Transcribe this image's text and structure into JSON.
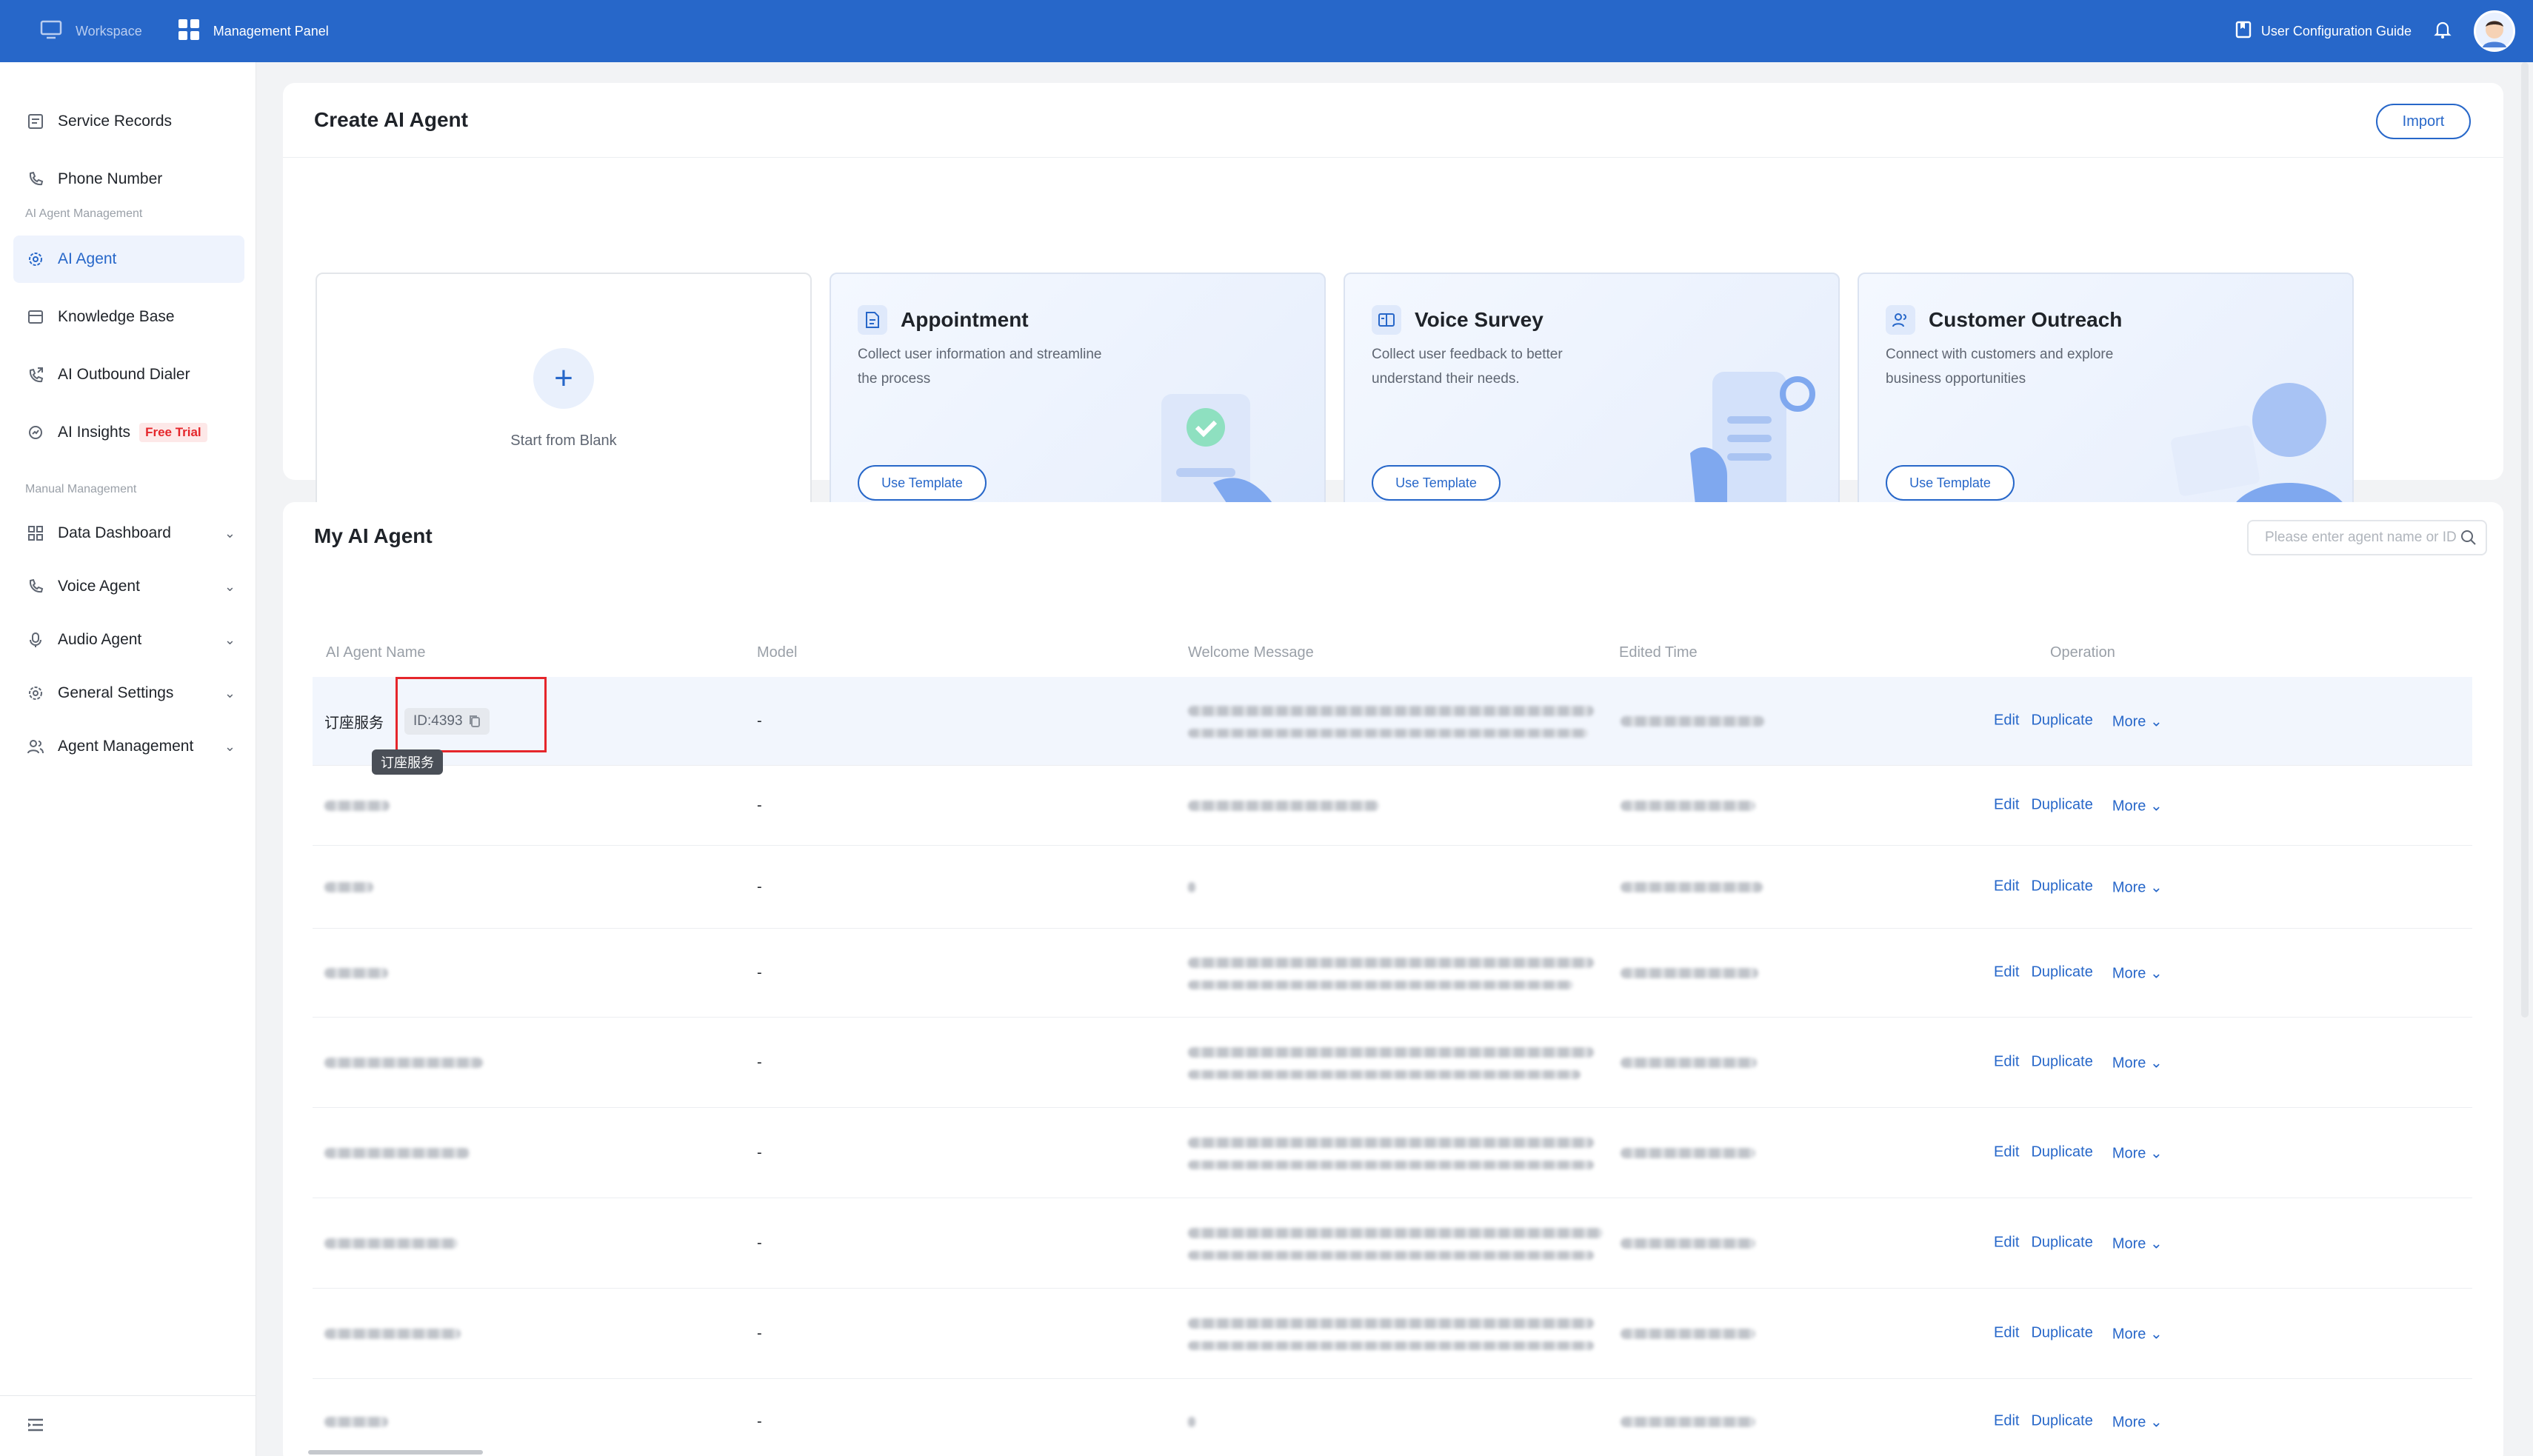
{
  "topbar": {
    "workspace": "Workspace",
    "management_panel": "Management Panel",
    "guide": "User Configuration Guide"
  },
  "sidebar": {
    "items": [
      {
        "label": "Service Records",
        "icon": "document-icon"
      },
      {
        "label": "Phone Number",
        "icon": "phone-icon"
      }
    ],
    "group_ai": "AI Agent Management",
    "ai_items": [
      {
        "label": "AI Agent",
        "icon": "gear-icon",
        "active": true
      },
      {
        "label": "Knowledge Base",
        "icon": "book-icon"
      },
      {
        "label": "AI Outbound Dialer",
        "icon": "phone-outbound-icon"
      },
      {
        "label": "AI Insights",
        "icon": "insights-icon",
        "badge": "Free Trial"
      }
    ],
    "group_manual": "Manual Management",
    "manual_items": [
      {
        "label": "Data Dashboard",
        "icon": "grid-icon"
      },
      {
        "label": "Voice Agent",
        "icon": "phone-icon"
      },
      {
        "label": "Audio Agent",
        "icon": "mic-icon"
      },
      {
        "label": "General Settings",
        "icon": "gear-icon"
      },
      {
        "label": "Agent Management",
        "icon": "users-icon"
      }
    ]
  },
  "create": {
    "title": "Create AI Agent",
    "import": "Import",
    "blank": "Start from Blank",
    "templates": [
      {
        "title": "Appointment",
        "desc": "Collect user information and streamline the process",
        "button": "Use Template"
      },
      {
        "title": "Voice Survey",
        "desc": "Collect user feedback to better understand their needs.",
        "button": "Use Template"
      },
      {
        "title": "Customer Outreach",
        "desc": "Connect with customers and explore business opportunities",
        "button": "Use Template"
      }
    ]
  },
  "my_agents": {
    "title": "My AI Agent",
    "search_placeholder": "Please enter agent name or ID",
    "columns": [
      "AI Agent Name",
      "Model",
      "Welcome Message",
      "Edited Time",
      "Operation"
    ],
    "first_row": {
      "name": "订座服务",
      "id": "ID:4393",
      "tooltip": "订座服务",
      "model": "-"
    },
    "rows": [
      {
        "model": "-"
      },
      {
        "model": "-"
      },
      {
        "model": "-"
      },
      {
        "model": "-"
      },
      {
        "model": "-"
      },
      {
        "model": "-"
      },
      {
        "model": "-"
      },
      {
        "model": "-"
      }
    ],
    "ops": {
      "edit": "Edit",
      "duplicate": "Duplicate",
      "more": "More"
    }
  }
}
